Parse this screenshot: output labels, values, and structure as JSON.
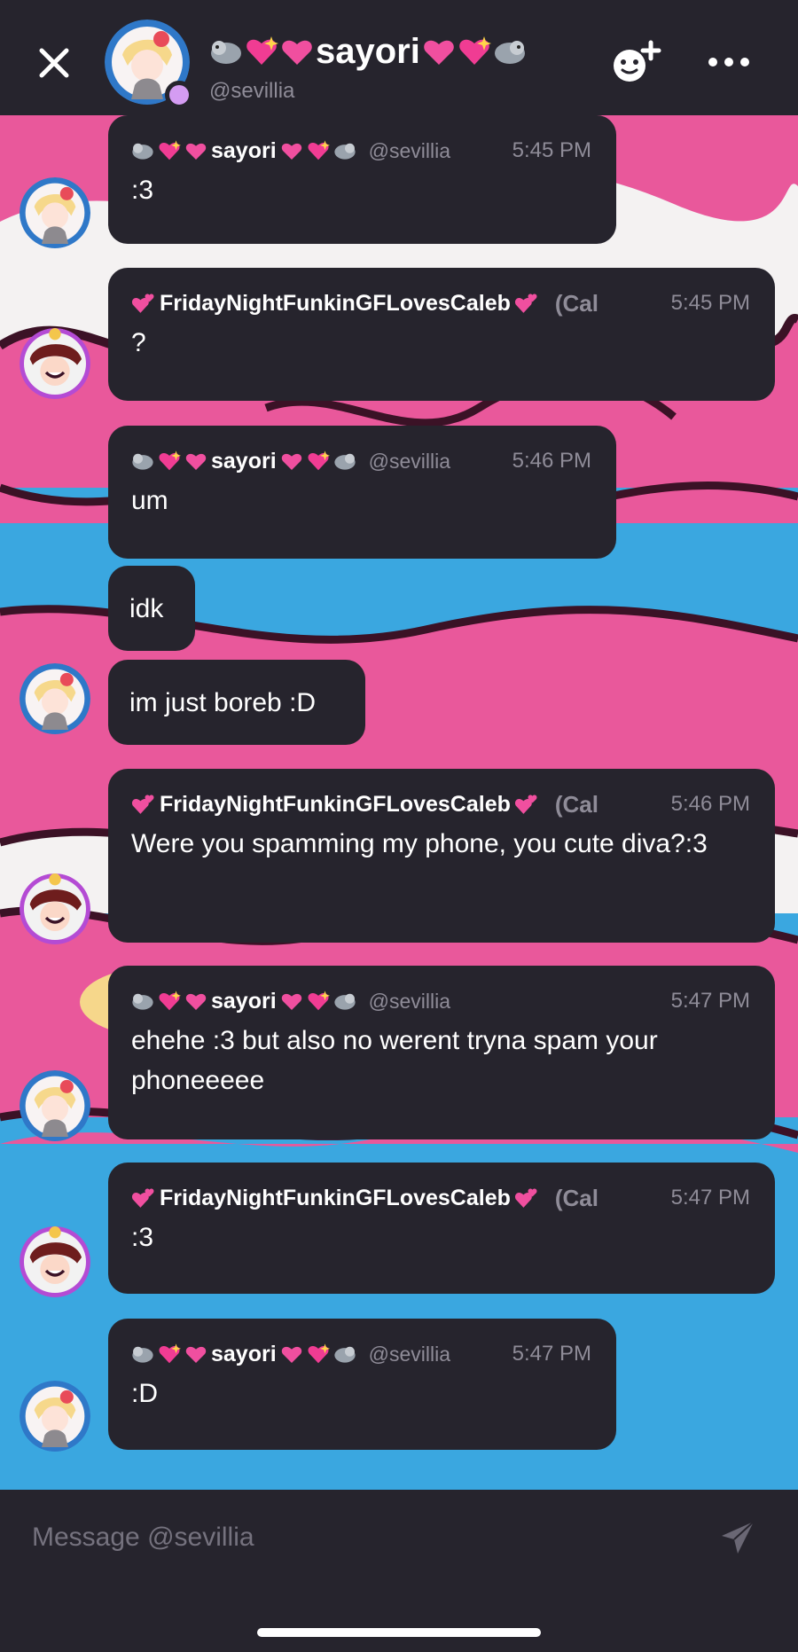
{
  "header": {
    "name": "sayori",
    "handle": "@sevillia",
    "icons": [
      "close-icon",
      "add-friend-icon",
      "more-icon"
    ]
  },
  "colors": {
    "panel": "#26242d",
    "muted": "#8f8c98",
    "online": "#d49cf2",
    "wall_pink": "#e9589b",
    "wall_blue": "#3aa7e0"
  },
  "messages": [
    {
      "author": "sayori",
      "handle": "@sevillia",
      "time": "5:45 PM",
      "lines": [
        ":3"
      ]
    },
    {
      "author": "FridayNightFunkinGFLovesCaleb",
      "clipped": "(Cal",
      "time": "5:45 PM",
      "lines": [
        "?"
      ]
    },
    {
      "author": "sayori",
      "handle": "@sevillia",
      "time": "5:46 PM",
      "lines": [
        "um"
      ]
    },
    {
      "lines": [
        "idk"
      ]
    },
    {
      "lines": [
        "im just boreb :D"
      ]
    },
    {
      "author": "FridayNightFunkinGFLovesCaleb",
      "clipped": "(Cal",
      "time": "5:46 PM",
      "lines": [
        "Were you spamming my phone, you cute diva?:3"
      ]
    },
    {
      "author": "sayori",
      "handle": "@sevillia",
      "time": "5:47 PM",
      "lines": [
        "ehehe :3 but also no werent tryna spam your phoneeeee"
      ]
    },
    {
      "author": "FridayNightFunkinGFLovesCaleb",
      "clipped": "(Cal",
      "time": "5:47 PM",
      "lines": [
        ":3"
      ]
    },
    {
      "author": "sayori",
      "handle": "@sevillia",
      "time": "5:47 PM",
      "lines": [
        ":D"
      ]
    }
  ],
  "composer": {
    "placeholder": "Message @sevillia"
  }
}
